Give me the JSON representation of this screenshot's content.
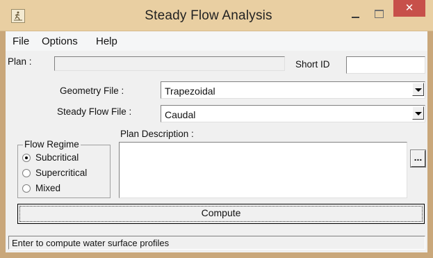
{
  "window": {
    "title": "Steady Flow Analysis",
    "close_glyph": "✕"
  },
  "menu": [
    "File",
    "Options",
    "Help"
  ],
  "plan": {
    "label": "Plan :",
    "value": "",
    "short_id_label": "Short ID",
    "short_id_value": ""
  },
  "geometry": {
    "label": "Geometry File :",
    "value": "Trapezoidal"
  },
  "steady_flow": {
    "label": "Steady Flow File :",
    "value": "Caudal"
  },
  "flow_regime": {
    "title": "Flow Regime",
    "options": [
      "Subcritical",
      "Supercritical",
      "Mixed"
    ],
    "selected": "Subcritical"
  },
  "plan_description": {
    "label": "Plan Description :",
    "value": "",
    "browse_label": "..."
  },
  "compute_label": "Compute",
  "status_text": "Enter to compute water surface profiles",
  "icons": {
    "app": "hec-ras-runner-icon",
    "minimize": "minimize-icon",
    "maximize": "maximize-icon",
    "close": "close-icon",
    "dropdown": "chevron-down-icon"
  },
  "colors": {
    "titlebar": "#e9cfa2",
    "close_button": "#c7504a",
    "dialog_face": "#f0f0f0"
  }
}
